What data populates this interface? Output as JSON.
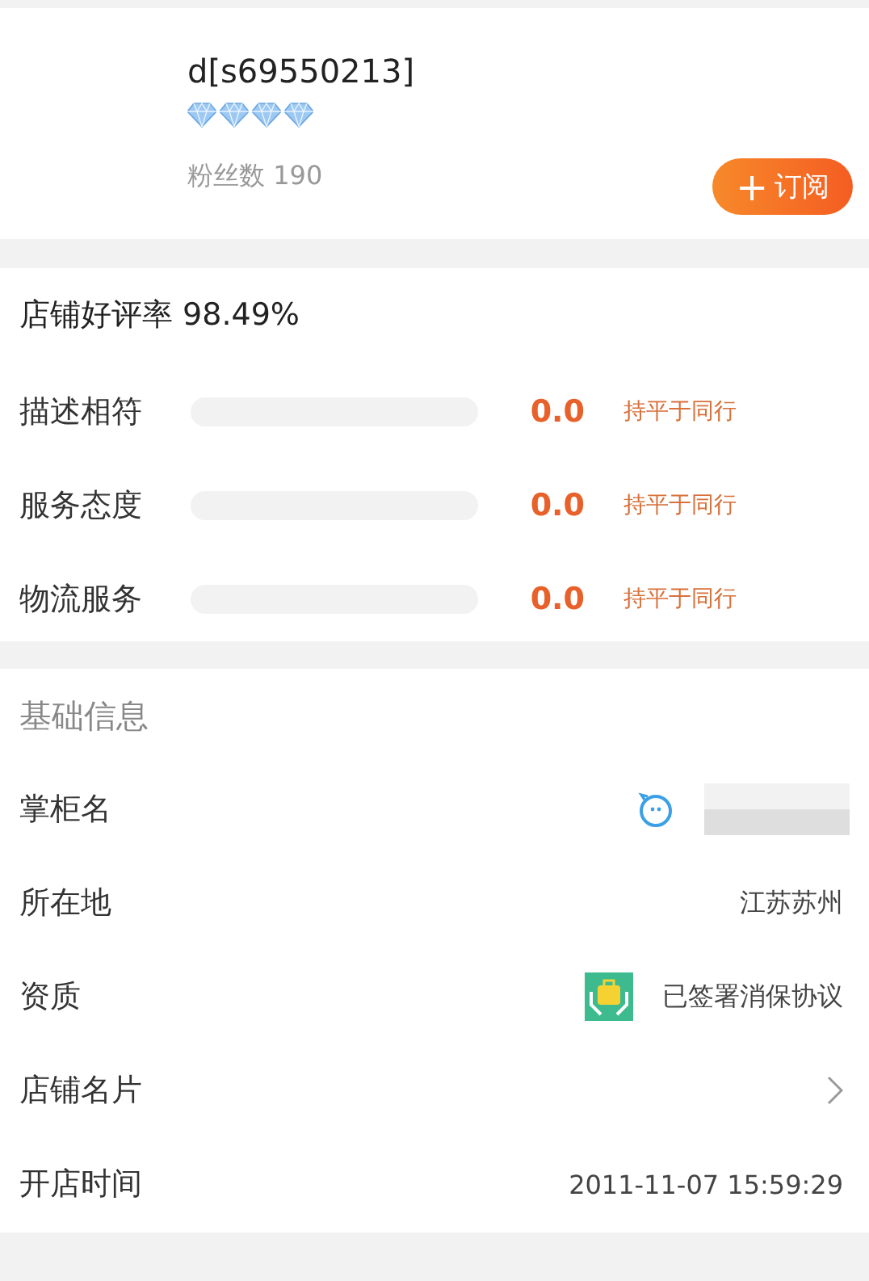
{
  "shop": {
    "name": "d[s69550213]",
    "stars": 4,
    "fans": "粉丝数 190",
    "subscribe": {
      "icon": "+",
      "label": "订阅"
    }
  },
  "ratings": {
    "summary": "店铺好评率 98.49%",
    "items": [
      {
        "label": "描述相符",
        "level": 0,
        "score": "0.0",
        "compare": "持平于同行"
      },
      {
        "label": "服务态度",
        "level": 0,
        "score": "0.0",
        "compare": "持平于同行"
      },
      {
        "label": "物流服务",
        "level": 0,
        "score": "0.0",
        "compare": "持平于同行"
      }
    ]
  },
  "info": {
    "title": "基础信息",
    "rows": [
      {
        "kind": "chat",
        "label": "掌柜名"
      },
      {
        "kind": "text",
        "label": "所在地",
        "value": "江苏苏州"
      },
      {
        "kind": "badge",
        "label": "资质",
        "value": "已签署消保协议"
      },
      {
        "kind": "arrow",
        "label": "店铺名片"
      },
      {
        "kind": "text",
        "label": "开店时间",
        "value": "2011-11-07 15:59:29"
      }
    ]
  }
}
